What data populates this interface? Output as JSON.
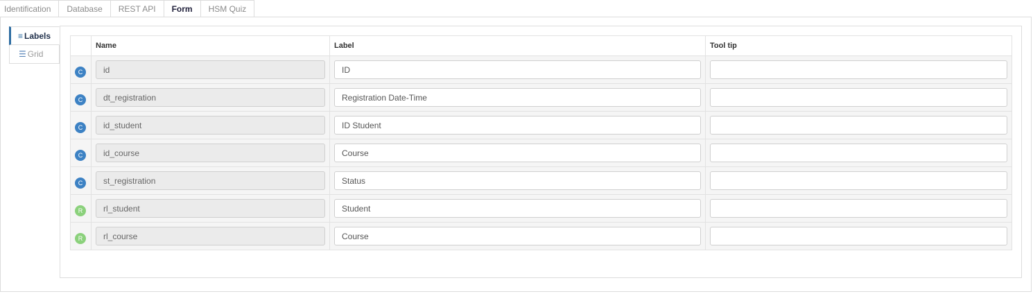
{
  "tabs": [
    "Identification",
    "Database",
    "REST API",
    "Form",
    "HSM Quiz"
  ],
  "active_tab": "Form",
  "side_nav": [
    {
      "label": "Labels",
      "icon": "list-icon",
      "active": true
    },
    {
      "label": "Grid",
      "icon": "grid-list-icon",
      "active": false
    }
  ],
  "columns": {
    "name": "Name",
    "label": "Label",
    "tooltip": "Tool tip"
  },
  "rows": [
    {
      "type": "C",
      "name": "id",
      "label": "ID",
      "tooltip": ""
    },
    {
      "type": "C",
      "name": "dt_registration",
      "label": "Registration Date-Time",
      "tooltip": ""
    },
    {
      "type": "C",
      "name": "id_student",
      "label": "ID Student",
      "tooltip": ""
    },
    {
      "type": "C",
      "name": "id_course",
      "label": "Course",
      "tooltip": ""
    },
    {
      "type": "C",
      "name": "st_registration",
      "label": "Status",
      "tooltip": ""
    },
    {
      "type": "R",
      "name": "rl_student",
      "label": "Student",
      "tooltip": ""
    },
    {
      "type": "R",
      "name": "rl_course",
      "label": "Course",
      "tooltip": ""
    }
  ],
  "colors": {
    "accent": "#2d6ca2",
    "badge_c": "#3d82c4",
    "badge_r": "#8bd17c"
  }
}
